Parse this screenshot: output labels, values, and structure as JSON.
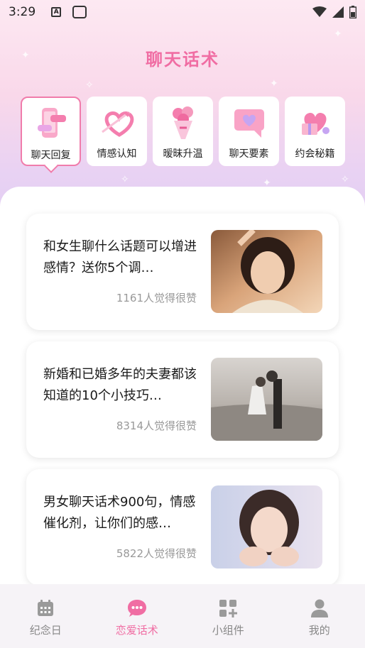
{
  "status_bar": {
    "time": "3:29"
  },
  "page_title": "聊天话术",
  "categories": [
    {
      "label": "聊天回复",
      "icon": "chat-phone-icon",
      "active": true
    },
    {
      "label": "情感认知",
      "icon": "heart-arrow-icon",
      "active": false
    },
    {
      "label": "暧昧升温",
      "icon": "rose-bouquet-icon",
      "active": false
    },
    {
      "label": "聊天要素",
      "icon": "heart-bubble-icon",
      "active": false
    },
    {
      "label": "约会秘籍",
      "icon": "gift-box-icon",
      "active": false
    }
  ],
  "articles": [
    {
      "title": "和女生聊什么话题可以增进感情？送你5个调…",
      "likes": "1161人觉得很赞",
      "image": "woman-portrait-photo"
    },
    {
      "title": "新婚和已婚多年的夫妻都该知道的10个小技巧…",
      "likes": "8314人觉得很赞",
      "image": "couple-beach-photo"
    },
    {
      "title": "男女聊天话术900句，情感催化剂，让你们的感…",
      "likes": "5822人觉得很赞",
      "image": "woman-portrait-photo"
    }
  ],
  "tabs": [
    {
      "label": "纪念日",
      "icon": "calendar-icon",
      "active": false
    },
    {
      "label": "恋爱话术",
      "icon": "chat-bubble-icon",
      "active": true
    },
    {
      "label": "小组件",
      "icon": "widgets-icon",
      "active": false
    },
    {
      "label": "我的",
      "icon": "profile-icon",
      "active": false
    }
  ],
  "colors": {
    "accent": "#f06da3",
    "tab_inactive": "#888888",
    "likes_text": "#999999"
  }
}
